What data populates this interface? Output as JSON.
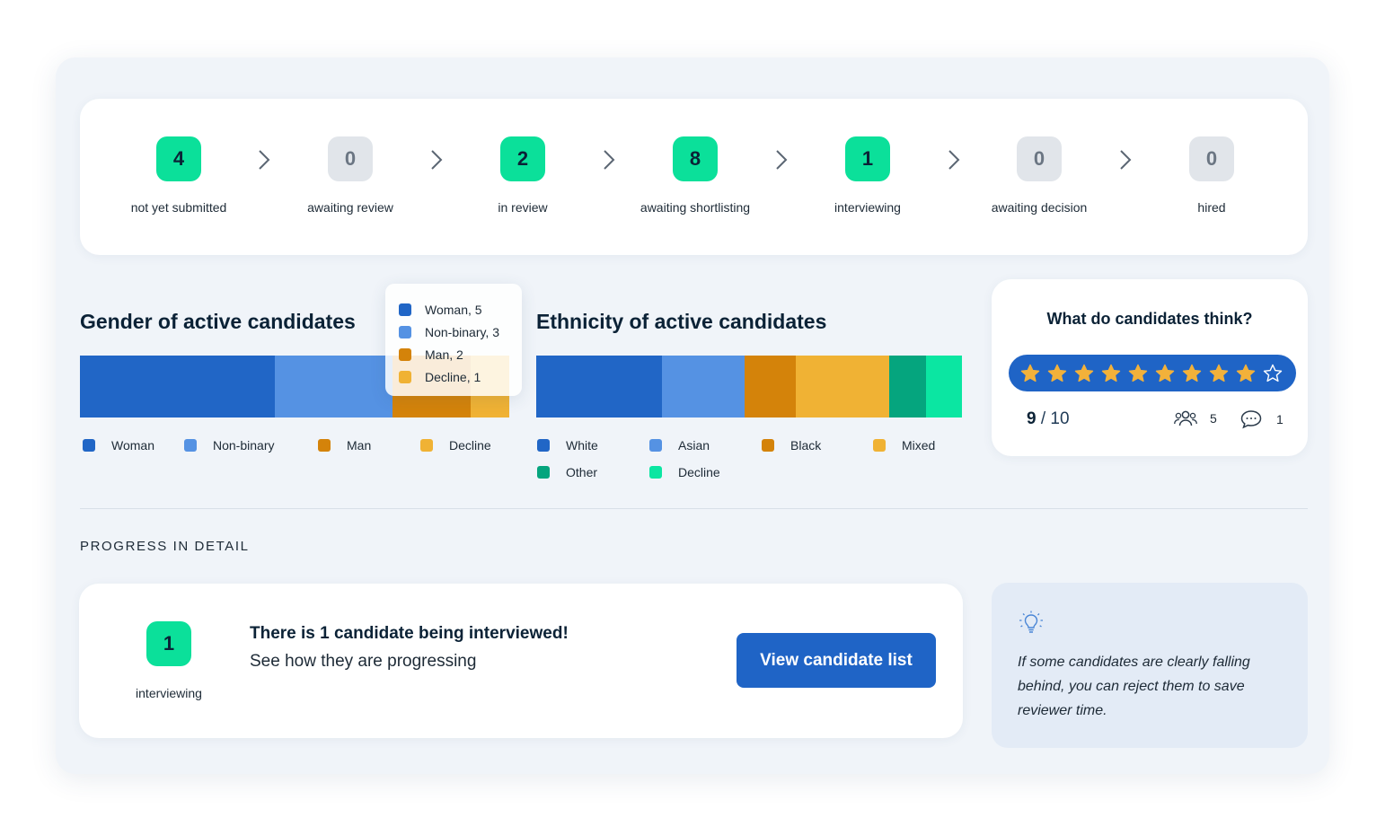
{
  "colors": {
    "active_badge": "#0be09a",
    "inactive_badge": "#e1e5ea",
    "primary": "#1f64c6",
    "star": "#f2b13a"
  },
  "pipeline": [
    {
      "count": "4",
      "label": "not yet submitted",
      "active": true
    },
    {
      "count": "0",
      "label": "awaiting review",
      "active": false
    },
    {
      "count": "2",
      "label": "in review",
      "active": true
    },
    {
      "count": "8",
      "label": "awaiting shortlisting",
      "active": true
    },
    {
      "count": "1",
      "label": "interviewing",
      "active": true
    },
    {
      "count": "0",
      "label": "awaiting decision",
      "active": false
    },
    {
      "count": "0",
      "label": "hired",
      "active": false
    }
  ],
  "gender": {
    "title": "Gender of active candidates",
    "legend": [
      "Woman",
      "Non-binary",
      "Man",
      "Decline"
    ],
    "tooltip": [
      "Woman, 5",
      "Non-binary, 3",
      "Man, 2",
      "Decline, 1"
    ]
  },
  "ethnicity": {
    "title": "Ethnicity of active candidates",
    "legend": [
      "White",
      "Asian",
      "Black",
      "Mixed",
      "Other",
      "Decline"
    ]
  },
  "chart_data": [
    {
      "type": "bar",
      "title": "Gender of active candidates",
      "stacked": true,
      "orientation": "horizontal",
      "categories": [
        "Woman",
        "Non-binary",
        "Man",
        "Decline"
      ],
      "values": [
        5,
        3,
        2,
        1
      ],
      "colors": [
        "#2166c6",
        "#5592e3",
        "#d4830a",
        "#f0b234"
      ]
    },
    {
      "type": "bar",
      "title": "Ethnicity of active candidates",
      "stacked": true,
      "orientation": "horizontal",
      "categories": [
        "White",
        "Asian",
        "Black",
        "Mixed",
        "Other",
        "Decline"
      ],
      "values": [
        29.5,
        19.5,
        12,
        22,
        8.5,
        8.5
      ],
      "colors": [
        "#2166c6",
        "#5592e3",
        "#d4830a",
        "#f0b234",
        "#05a57e",
        "#0be6a2"
      ]
    }
  ],
  "rating": {
    "title": "What do candidates think?",
    "stars_filled": 9,
    "stars_total": 10,
    "score": "9",
    "separator": "/",
    "out_of": "10",
    "respondents": "5",
    "comments": "1"
  },
  "section_label": "PROGRESS IN DETAIL",
  "detail": {
    "count": "1",
    "label": "interviewing",
    "headline": "There is 1 candidate being interviewed!",
    "subline": "See how they are progressing",
    "button": "View candidate list"
  },
  "tip": {
    "text": "If some candidates are clearly falling behind, you can reject them to save reviewer time."
  }
}
